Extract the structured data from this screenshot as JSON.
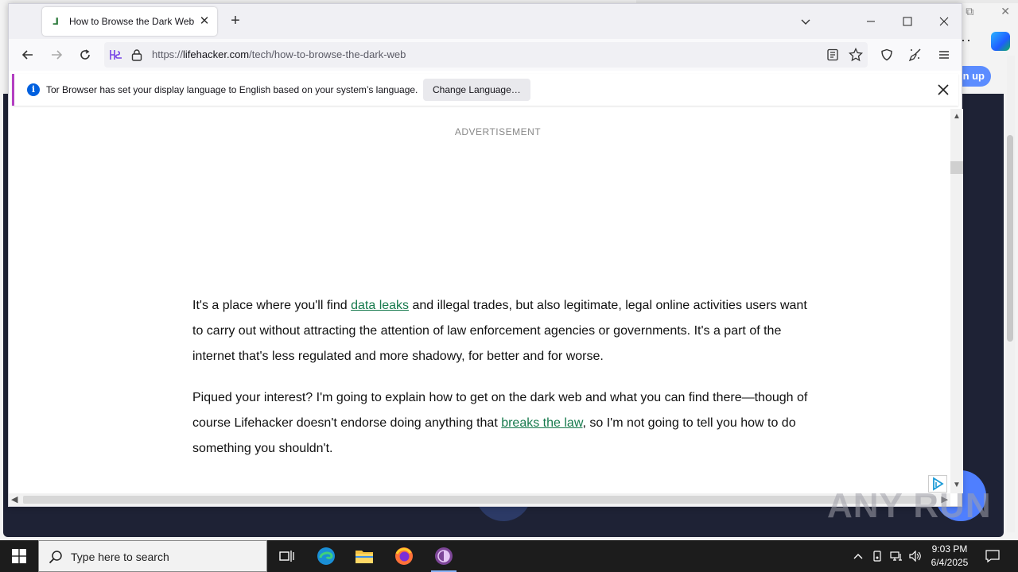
{
  "browser": {
    "tab": {
      "title": "How to Browse the Dark Web"
    },
    "url": {
      "scheme": "https://",
      "host": "lifehacker.com",
      "path": "/tech/how-to-browse-the-dark-web"
    },
    "notification": {
      "text": "Tor Browser has set your display language to English based on your system’s language.",
      "button_label": "Change Language…"
    }
  },
  "page": {
    "ad_label": "ADVERTISEMENT",
    "paragraph1": {
      "part1": "It's a place where you'll find ",
      "link1": "data leaks",
      "part2": " and illegal trades, but also legitimate, legal online activities users want to carry out without attracting the attention of law enforcement agencies or governments. It's a part of the internet that's less regulated and more shadowy, for better and for worse."
    },
    "paragraph2": {
      "part1": "Piqued your interest? I'm going to explain how to get on the dark web and what you can find there—though of course Lifehacker doesn't endorse doing anything that ",
      "link1": "breaks the law",
      "part2": ", so I'm not going to tell you how to do something you shouldn't."
    }
  },
  "background_app": {
    "signup_fragment": "n up"
  },
  "watermark": "ANY RUN",
  "taskbar": {
    "search_placeholder": "Type here to search",
    "time": "9:03 PM",
    "date": "6/4/2025"
  },
  "colors": {
    "link": "#177a4d",
    "tor_accent": "#b33fc2",
    "info": "#0060df",
    "taskbar": "#1c1c1c"
  }
}
